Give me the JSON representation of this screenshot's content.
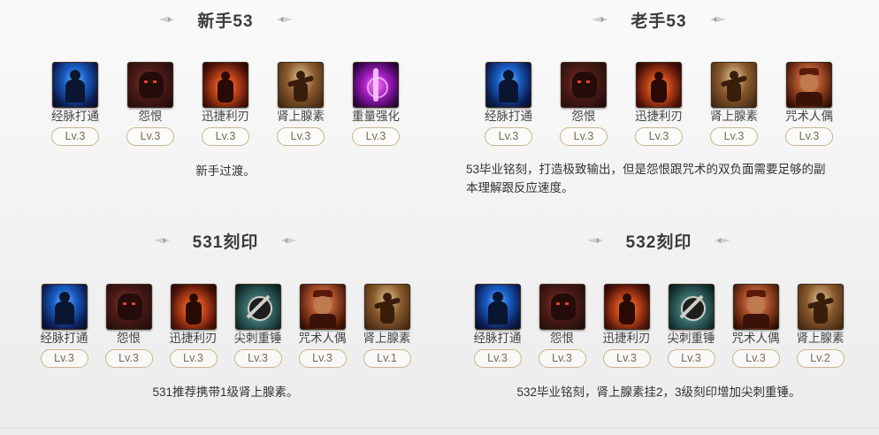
{
  "sections": [
    {
      "id": "novice",
      "title": "新手53",
      "skills": [
        {
          "name": "经脉打通",
          "level": "Lv.3",
          "icon": "meridian-icon"
        },
        {
          "name": "怨恨",
          "level": "Lv.3",
          "icon": "grudge-icon"
        },
        {
          "name": "迅捷利刃",
          "level": "Lv.3",
          "icon": "swift-blade-icon"
        },
        {
          "name": "肾上腺素",
          "level": "Lv.3",
          "icon": "adrenaline-icon"
        },
        {
          "name": "重量强化",
          "level": "Lv.3",
          "icon": "weight-boost-icon"
        }
      ],
      "description": "新手过渡。"
    },
    {
      "id": "veteran",
      "title": "老手53",
      "skills": [
        {
          "name": "经脉打通",
          "level": "Lv.3",
          "icon": "meridian-icon"
        },
        {
          "name": "怨恨",
          "level": "Lv.3",
          "icon": "grudge-icon"
        },
        {
          "name": "迅捷利刃",
          "level": "Lv.3",
          "icon": "swift-blade-icon"
        },
        {
          "name": "肾上腺素",
          "level": "Lv.3",
          "icon": "adrenaline-icon"
        },
        {
          "name": "咒术人偶",
          "level": "Lv.3",
          "icon": "curse-doll-icon"
        }
      ],
      "description_lines": [
        "53毕业铭刻，打造极致输出，但是怨恨跟咒术的双负面需要足够的副",
        "本理解跟反应速度。"
      ]
    },
    {
      "id": "set531",
      "title": "531刻印",
      "skills": [
        {
          "name": "经脉打通",
          "level": "Lv.3",
          "icon": "meridian-icon"
        },
        {
          "name": "怨恨",
          "level": "Lv.3",
          "icon": "grudge-icon"
        },
        {
          "name": "迅捷利刃",
          "level": "Lv.3",
          "icon": "swift-blade-icon"
        },
        {
          "name": "尖刺重锤",
          "level": "Lv.3",
          "icon": "spiked-hammer-icon"
        },
        {
          "name": "咒术人偶",
          "level": "Lv.3",
          "icon": "curse-doll-icon"
        },
        {
          "name": "肾上腺素",
          "level": "Lv.1",
          "icon": "adrenaline-icon"
        }
      ],
      "description": "531推荐携带1级肾上腺素。"
    },
    {
      "id": "set532",
      "title": "532刻印",
      "skills": [
        {
          "name": "经脉打通",
          "level": "Lv.3",
          "icon": "meridian-icon"
        },
        {
          "name": "怨恨",
          "level": "Lv.3",
          "icon": "grudge-icon"
        },
        {
          "name": "迅捷利刃",
          "level": "Lv.3",
          "icon": "swift-blade-icon"
        },
        {
          "name": "尖刺重锤",
          "level": "Lv.3",
          "icon": "spiked-hammer-icon"
        },
        {
          "name": "咒术人偶",
          "level": "Lv.3",
          "icon": "curse-doll-icon"
        },
        {
          "name": "肾上腺素",
          "level": "Lv.2",
          "icon": "adrenaline-icon"
        }
      ],
      "description": "532毕业铭刻，肾上腺素挂2，3级刻印增加尖刺重锤。"
    }
  ],
  "colors": {
    "title": "#3b3b3b",
    "level_border": "#c8b48a",
    "level_text": "#7a6a50"
  }
}
